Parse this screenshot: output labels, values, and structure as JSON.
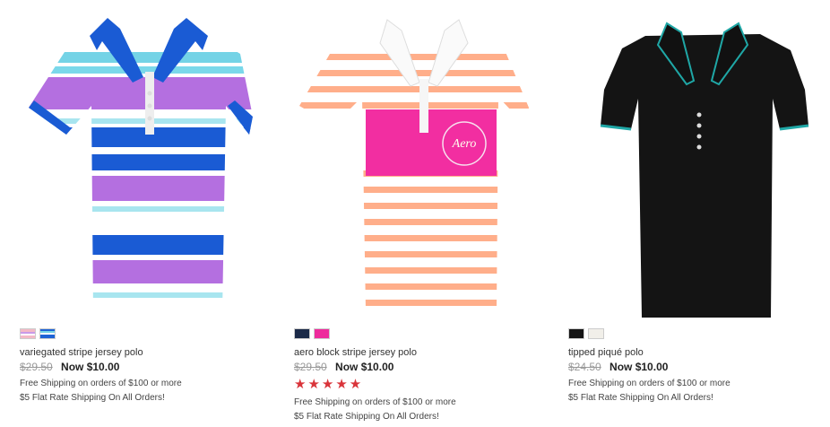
{
  "products": [
    {
      "name": "variegated stripe jersey polo",
      "original_price": "$29.50",
      "sale_price": "Now $10.00",
      "promo_shipping": "Free Shipping on orders of $100 or more",
      "promo_flat_rate": "$5 Flat Rate Shipping On All Orders!",
      "swatch_colors": [
        "#f3b9c6",
        "#1e63d6"
      ],
      "rating_stars": null
    },
    {
      "name": "aero block stripe jersey polo",
      "original_price": "$29.50",
      "sale_price": "Now $10.00",
      "rating_stars": 5,
      "rating_display": "★★★★★",
      "promo_shipping": "Free Shipping on orders of $100 or more",
      "promo_flat_rate": "$5 Flat Rate Shipping On All Orders!",
      "swatch_colors": [
        "#1b2a48",
        "#ee2b9c"
      ]
    },
    {
      "name": "tipped piqué polo",
      "original_price": "$24.50",
      "sale_price": "Now $10.00",
      "promo_shipping": "Free Shipping on orders of $100 or more",
      "promo_flat_rate": "$5 Flat Rate Shipping On All Orders!",
      "swatch_colors": [
        "#151515",
        "#f1efe9"
      ],
      "rating_stars": null
    }
  ],
  "colors": {
    "star": "#d9343a",
    "strike": "#999999"
  }
}
